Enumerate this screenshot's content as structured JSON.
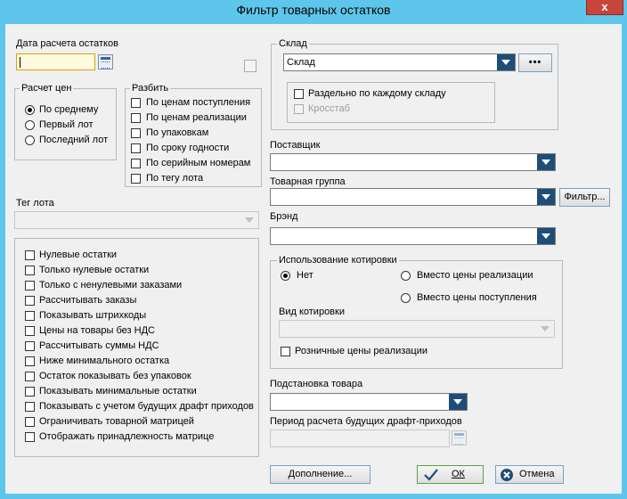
{
  "window": {
    "title": "Фильтр товарных остатков",
    "close_glyph": "x"
  },
  "calc_date": {
    "label": "Дата расчета остатков",
    "value": ""
  },
  "price_calc": {
    "title": "Расчет цен",
    "options": [
      {
        "label": "По среднему",
        "selected": true
      },
      {
        "label": "Первый лот",
        "selected": false
      },
      {
        "label": "Последний лот",
        "selected": false
      }
    ]
  },
  "split": {
    "title": "Разбить",
    "options": [
      "По ценам поступления",
      "По ценам реализации",
      "По упаковкам",
      "По сроку годности",
      "По серийным номерам",
      "По тегу лота"
    ]
  },
  "lot_tag": {
    "label": "Тег лота",
    "value": ""
  },
  "flags": [
    "Нулевые остатки",
    "Только нулевые остатки",
    "Только с ненулевыми заказами",
    "Рассчитывать заказы",
    "Показывать штрихкоды",
    "Цены на товары без НДС",
    "Рассчитывать суммы НДС",
    "Ниже минимального остатка",
    "Остаток показывать без упаковок",
    "Показывать минимальные остатки",
    "Показывать с учетом будущих драфт приходов",
    "Ограничивать товарной матрицей",
    "Отображать принадлежность матрице"
  ],
  "warehouse": {
    "title": "Склад",
    "value": "Склад",
    "more_label": "•••",
    "separate_label": "Раздельно по каждому складу",
    "crosstab_label": "Кросстаб"
  },
  "supplier": {
    "label": "Поставщик",
    "value": ""
  },
  "product_group": {
    "label": "Товарная группа",
    "value": "",
    "filter_label": "Фильтр..."
  },
  "brand": {
    "label": "Брэнд",
    "value": ""
  },
  "quote": {
    "title": "Использование котировки",
    "none_label": "Нет",
    "instead_sale_label": "Вместо цены реализации",
    "instead_receipt_label": "Вместо цены поступления",
    "kind_label": "Вид котировки",
    "kind_value": "",
    "retail_label": "Розничные цены реализации"
  },
  "substitution": {
    "label": "Подстановка товара",
    "value": ""
  },
  "draft_period": {
    "label": "Период расчета будущих драфт-приходов",
    "value": ""
  },
  "buttons": {
    "addition": "Дополнение...",
    "ok": "ОК",
    "cancel": "Отмена"
  },
  "colors": {
    "title_bar": "#5ec6ea",
    "dropdown_arrow": "#1d4e78",
    "close": "#c7453d"
  }
}
